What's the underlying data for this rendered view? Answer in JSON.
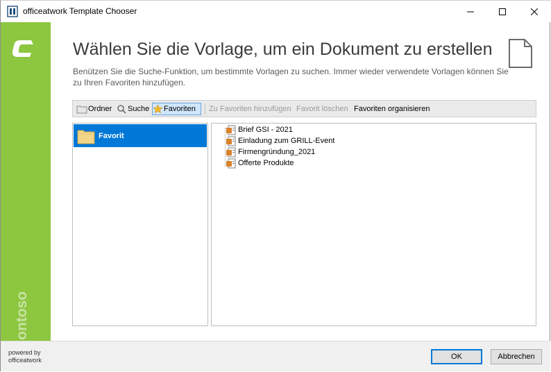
{
  "window": {
    "title": "officeatwork Template Chooser",
    "controls": {
      "minimize": "minimize-icon",
      "maximize": "maximize-icon",
      "close": "close-icon"
    }
  },
  "sidebar": {
    "logo_letter": "C",
    "brand": "Contoso",
    "color": "#8dc63f"
  },
  "header": {
    "title": "Wählen Sie die Vorlage, um ein Dokument zu erstellen",
    "description": "Benützen Sie die Suche-Funktion, um bestimmte Vorlagen zu suchen. Immer wieder verwendete Vorlagen können Sie zu Ihren Favoriten hinzufügen."
  },
  "toolbar": {
    "ordner": "Ordner",
    "suche": "Suche",
    "favoriten": "Favoriten",
    "add_favorite": "Zu Favoriten hinzufügen",
    "delete_favorite": "Favorit löschen",
    "organize_favorites": "Favoriten organisieren"
  },
  "left_pane": {
    "items": [
      {
        "label": "Favorit",
        "selected": true
      }
    ]
  },
  "templates": [
    {
      "label": "Brief GSI - 2021"
    },
    {
      "label": "Einladung zum GRILL-Event"
    },
    {
      "label": "Firmengründung_2021"
    },
    {
      "label": "Offerte Produkte"
    }
  ],
  "footer": {
    "powered_line1": "powered by",
    "powered_line2": "officeatwork",
    "ok": "OK",
    "cancel": "Abbrechen"
  },
  "colors": {
    "accent": "#0078d7",
    "brand_green": "#8dc63f"
  }
}
